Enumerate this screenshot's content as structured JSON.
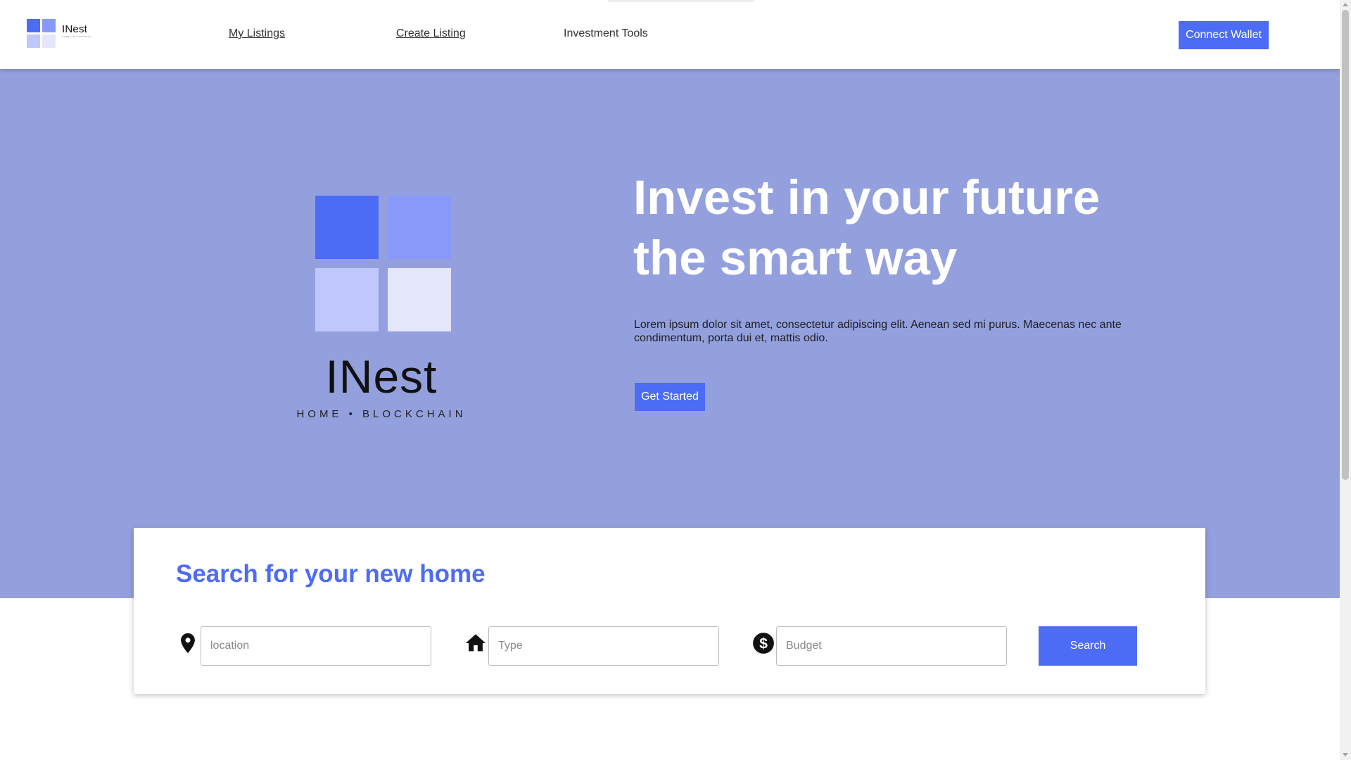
{
  "colors": {
    "accent": "#4d6cf5",
    "hero_bg": "#93a0dd",
    "logo_tiles": [
      "#4d6cf5",
      "#8899fa",
      "#c0c8fb",
      "#e4e7fc"
    ]
  },
  "header": {
    "brand_name": "INest",
    "brand_tagline": "HOME • BLOCKCHAIN",
    "nav": {
      "my_listings": "My Listings",
      "create_listing": "Create Listing",
      "investment_tools": "Investment Tools"
    },
    "connect_wallet": "Connect Wallet"
  },
  "hero": {
    "logo_word": "INest",
    "logo_tagline": "HOME • BLOCKCHAIN",
    "title": "Invest in your future the smart way",
    "description": "Lorem ipsum dolor sit amet, consectetur adipiscing elit. Aenean sed mi purus. Maecenas nec ante condimentum, porta dui et, mattis odio.",
    "cta": "Get Started"
  },
  "search": {
    "title": "Search for your new home",
    "location_placeholder": "location",
    "type_placeholder": "Type",
    "budget_placeholder": "Budget",
    "button": "Search",
    "icons": [
      "location-pin-icon",
      "home-icon",
      "dollar-icon"
    ]
  }
}
